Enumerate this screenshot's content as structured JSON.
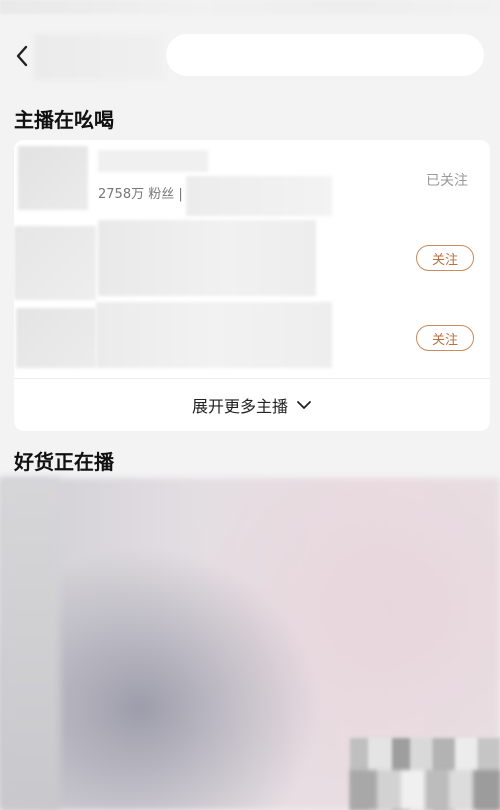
{
  "header": {
    "back_icon": "chevron-left-icon",
    "search_value": ""
  },
  "streamers_section": {
    "title": "主播在吆喝",
    "items": [
      {
        "fans": "2758万 粉丝 |",
        "status_label": "已关注"
      },
      {
        "button_label": "关注"
      },
      {
        "button_label": "关注"
      }
    ],
    "expand_label": "展开更多主播",
    "expand_icon": "chevron-down-icon"
  },
  "goods_section": {
    "title": "好货正在播"
  },
  "colors": {
    "accent": "#b8723f",
    "background": "#f3f3f3"
  }
}
